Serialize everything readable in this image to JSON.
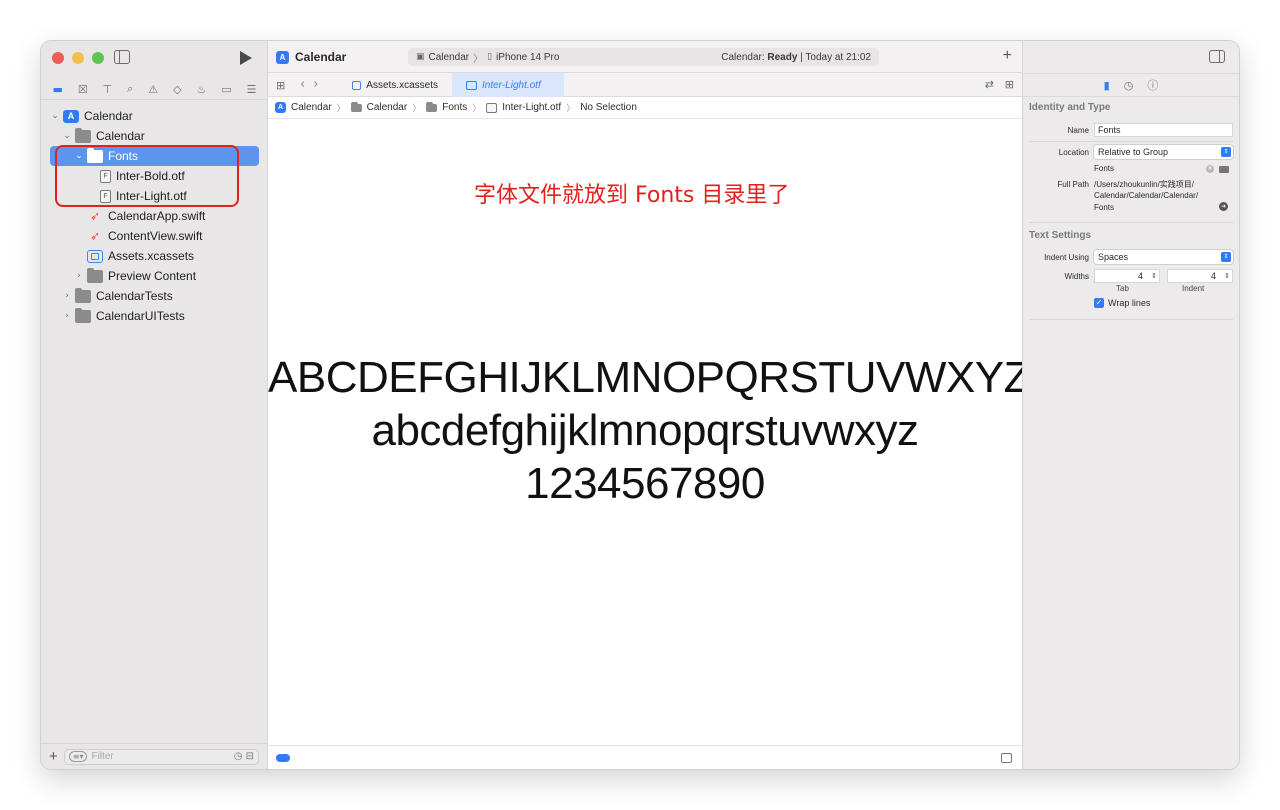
{
  "navigator": {
    "icon_names": [
      "folder-icon",
      "xmark-box-icon",
      "hierarchy-icon",
      "search-icon",
      "warning-icon",
      "diamond-icon",
      "spray-icon",
      "tag-icon",
      "report-icon"
    ],
    "items": [
      {
        "label": "Calendar",
        "type": "project",
        "expanded": true
      },
      {
        "label": "Calendar",
        "type": "folder",
        "expanded": true
      },
      {
        "label": "Fonts",
        "type": "folder",
        "expanded": true,
        "selected": true
      },
      {
        "label": "Inter-Bold.otf",
        "type": "file"
      },
      {
        "label": "Inter-Light.otf",
        "type": "file"
      },
      {
        "label": "CalendarApp.swift",
        "type": "swift"
      },
      {
        "label": "ContentView.swift",
        "type": "swift"
      },
      {
        "label": "Assets.xcassets",
        "type": "assets"
      },
      {
        "label": "Preview Content",
        "type": "folder",
        "expanded": false
      },
      {
        "label": "CalendarTests",
        "type": "folder",
        "expanded": false
      },
      {
        "label": "CalendarUITests",
        "type": "folder",
        "expanded": false
      }
    ],
    "filter_placeholder": "Filter"
  },
  "toolbar": {
    "project_title": "Calendar",
    "scheme": "Calendar",
    "device": "iPhone 14 Pro",
    "status_prefix": "Calendar:",
    "status_bold": "Ready",
    "status_suffix": "| Today at 21:02"
  },
  "tabs": [
    {
      "label": "Assets.xcassets",
      "active": false
    },
    {
      "label": "Inter-Light.otf",
      "active": true
    }
  ],
  "jumpbar": [
    "Calendar",
    "Calendar",
    "Fonts",
    "Inter-Light.otf",
    "No Selection"
  ],
  "preview": {
    "line1": "ABCDEFGHIJKLMNOPQRSTUVWXYZ",
    "line2": "abcdefghijklmnopqrstuvwxyz",
    "line3": "1234567890"
  },
  "annotation": {
    "text": "字体文件就放到 Fonts 目录里了",
    "color": "#e0211c"
  },
  "inspector": {
    "identity_title": "Identity and Type",
    "name_label": "Name",
    "name_value": "Fonts",
    "location_label": "Location",
    "location_value": "Relative to Group",
    "location_folder": "Fonts",
    "fullpath_label": "Full Path",
    "fullpath_lines": [
      "/Users/zhoukunlin/实践项目/",
      "Calendar/Calendar/Calendar/",
      "Fonts"
    ],
    "text_settings_title": "Text Settings",
    "indent_label": "Indent Using",
    "indent_value": "Spaces",
    "widths_label": "Widths",
    "tab_value": "4",
    "indent_width_value": "4",
    "tab_caption": "Tab",
    "indent_caption": "Indent",
    "wrap_label": "Wrap lines",
    "wrap_checked": true
  },
  "colors": {
    "accent": "#2f7cf6",
    "selection": "#5d95ec",
    "annotation": "#e0211c"
  }
}
